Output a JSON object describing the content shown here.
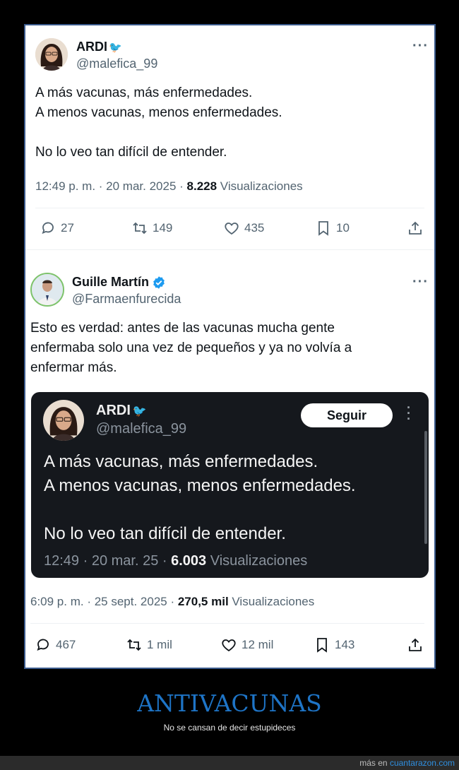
{
  "tweet1": {
    "name": "ARDI",
    "name_emoji": "🐦",
    "handle": "@malefica_99",
    "text": "A más vacunas, más enfermedades.\nA menos vacunas, menos enfermedades.\n\nNo lo veo tan difícil de entender.",
    "time": "12:49 p. m. · 20 mar. 2025 · ",
    "views_count": "8.228",
    "views_label": " Visualizaciones",
    "replies": "27",
    "retweets": "149",
    "likes": "435",
    "bookmarks": "10"
  },
  "tweet2": {
    "name": "Guille Martín",
    "verified": true,
    "handle": "@Farmaenfurecida",
    "text": "Esto es verdad: antes de las vacunas mucha gente\nenfermaba solo una vez de pequeños y ya no volvía a\nenfermar más.",
    "time": "6:09 p. m. · 25 sept. 2025 · ",
    "views_count": "270,5 mil",
    "views_label": " Visualizaciones",
    "replies": "467",
    "retweets": "1 mil",
    "likes": "12 mil",
    "bookmarks": "143"
  },
  "embed": {
    "name": "ARDI",
    "handle": "@malefica_99",
    "follow_label": "Seguir",
    "text": "A más vacunas, más enfermedades.\nA menos vacunas, menos enfermedades.\n\nNo lo veo tan difícil de entender.",
    "time": "12:49 · 20 mar. 25 · ",
    "views_count": "6.003",
    "views_label": " Visualizaciones"
  },
  "caption": {
    "title": "ANTIVACUNAS",
    "subtitle": "No se cansan de decir estupideces"
  },
  "footer": {
    "prefix": "más en ",
    "site": "cuantarazon.com"
  },
  "colors": {
    "verified": "#1d9bf0",
    "caption_title": "#1e74c6",
    "border": "#3a5a8c"
  }
}
